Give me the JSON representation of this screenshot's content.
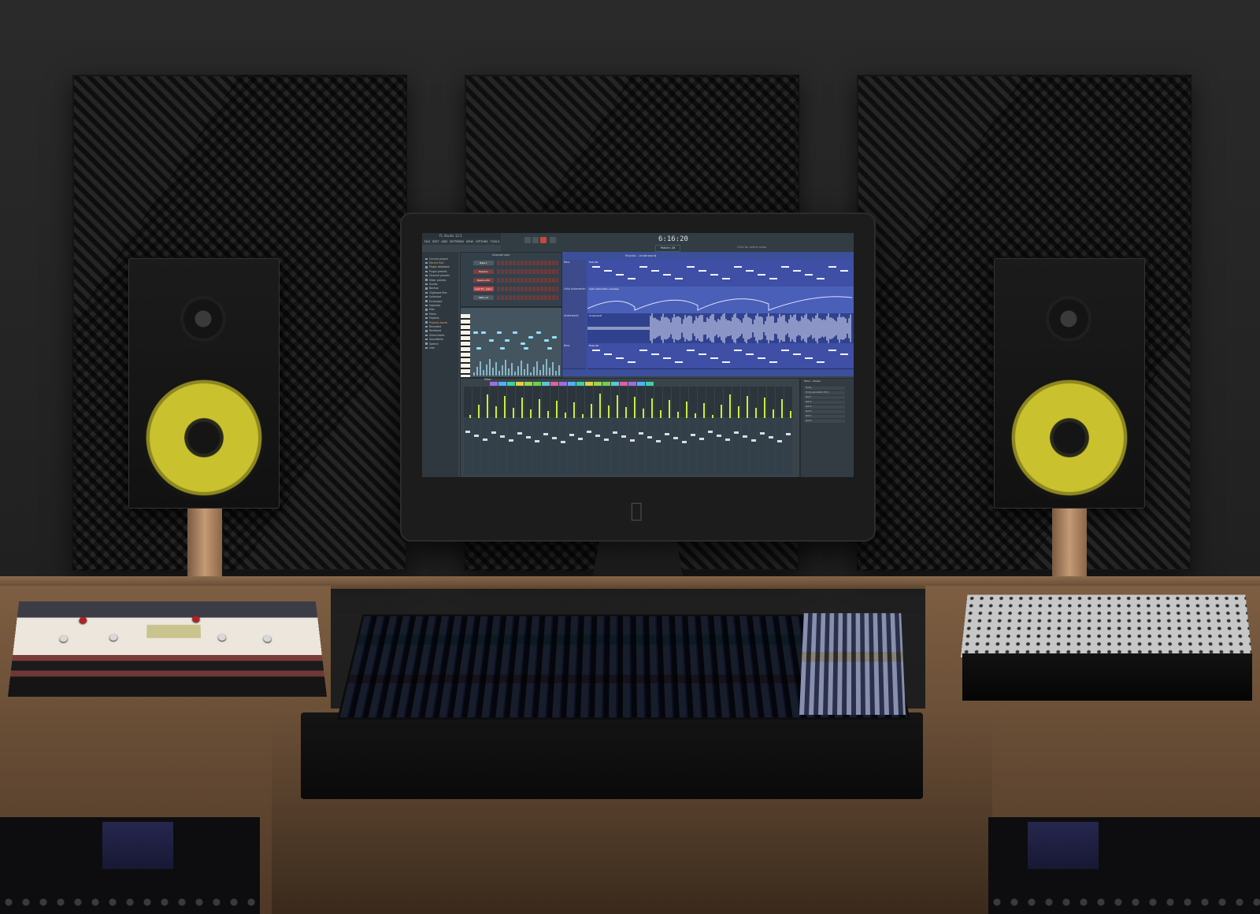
{
  "scene": {
    "colors": {
      "wall": "#262626",
      "woofer_cone": "#c9c12e",
      "desk_wood": "#7d5e42",
      "mixer_panel": "#5a6fb0"
    }
  },
  "daw": {
    "app_title": "FL Studio 12.5",
    "menu": [
      "FILE",
      "EDIT",
      "ADD",
      "PATTERNS",
      "VIEW",
      "OPTIONS",
      "TOOLS",
      "?"
    ],
    "time_display": "6:16:20",
    "pattern_selector": "Pattern 26",
    "online_news": "Click for online news",
    "browser_items": [
      "Current project",
      "Recent files",
      "Plugin database",
      "Plugin presets",
      "Channel presets",
      "Mixer presets",
      "Scores",
      "Backup",
      "Clipboard files",
      "Collected",
      "Envelopes",
      "Impulses",
      "Misc",
      "Packs",
      "Projects",
      "Projects bones",
      "Recorded",
      "Rendered",
      "Sliced beats",
      "Soundfonts",
      "Speech",
      "User"
    ],
    "channel_rack": {
      "title": "Channel rack",
      "channels": [
        "Bass 1",
        "Bassline",
        "Bassline B2",
        "Lead FX - piano",
        "MIDI out"
      ]
    },
    "playlist": {
      "title": "Playlist - Underworld",
      "tracks": [
        {
          "name": "Bass",
          "clip": "Flute B1"
        },
        {
          "name": "Cello Automation",
          "clip": "Cello Automation envelope"
        },
        {
          "name": "Underworld",
          "clip": "Underworld"
        },
        {
          "name": "Bass",
          "clip": "Brass B1"
        }
      ]
    },
    "mixer": {
      "title": "Mixer"
    },
    "fx_panel": {
      "title": "Mixer - Master",
      "slots": [
        "Fruity",
        "Fruity parametric EQ 2",
        "Slot 3",
        "Slot 4",
        "Slot 5",
        "Slot 6",
        "Slot 7",
        "Slot 8"
      ]
    }
  }
}
